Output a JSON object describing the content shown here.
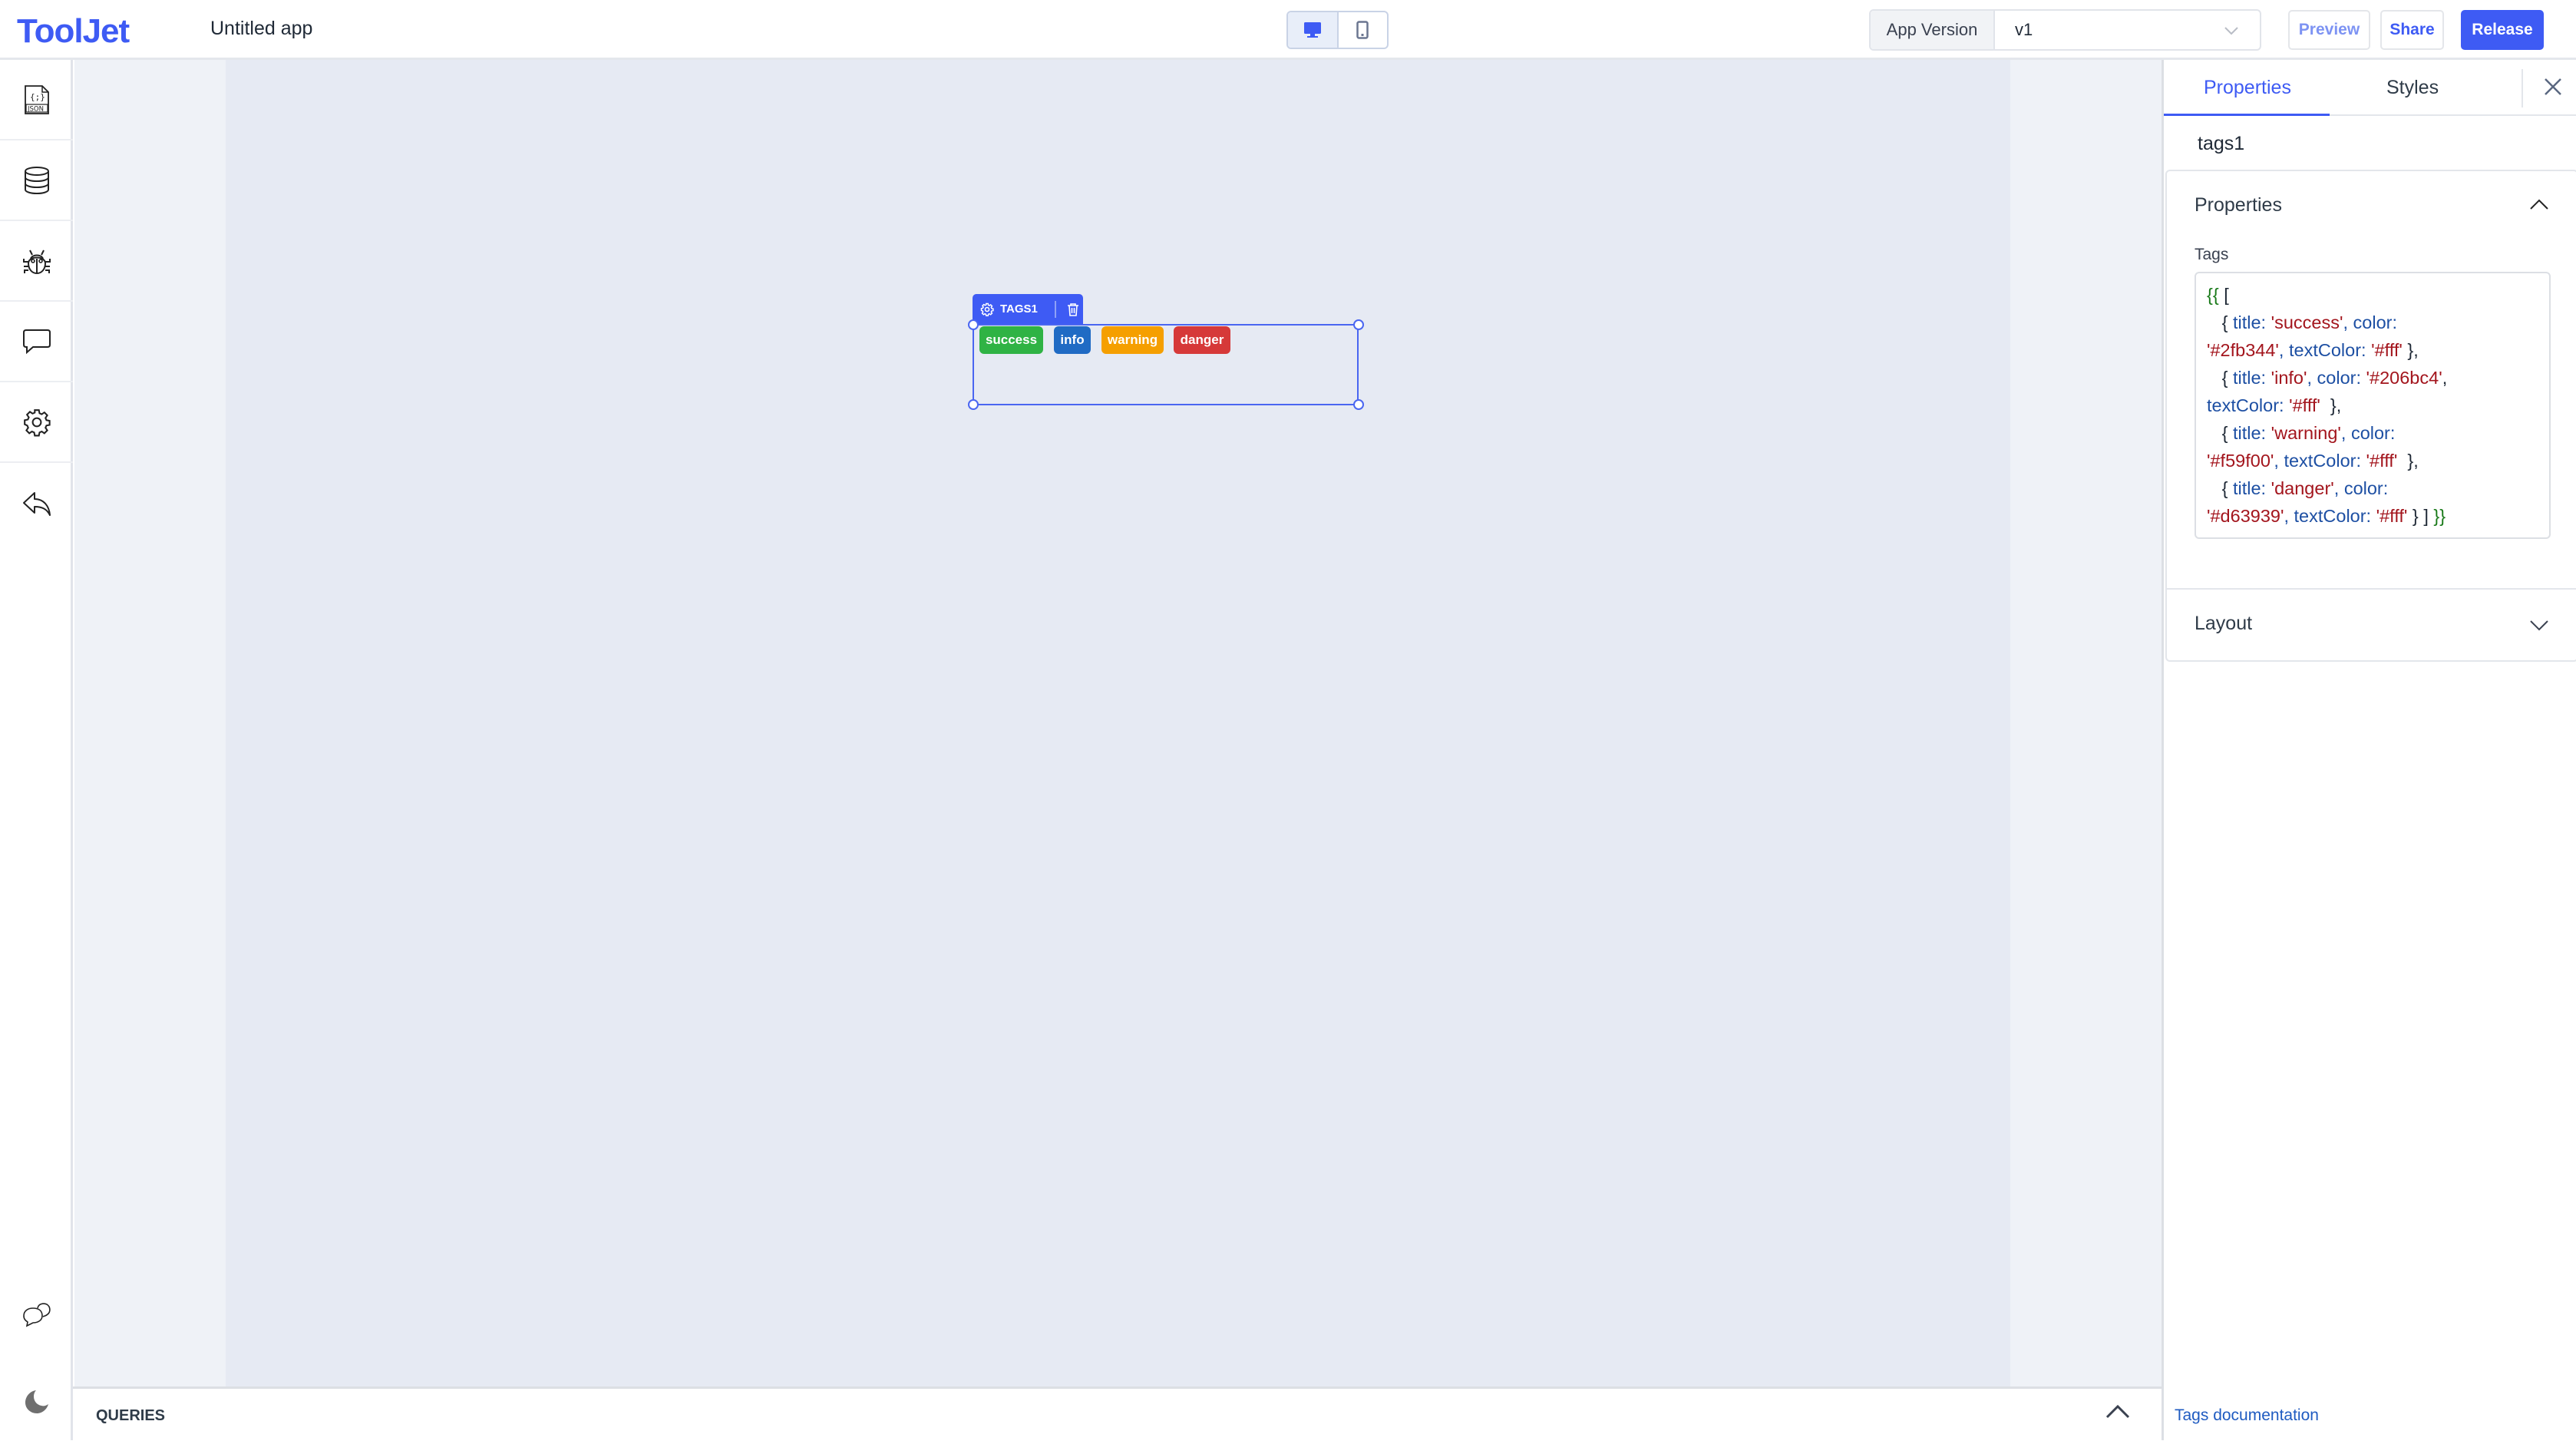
{
  "header": {
    "logo": "ToolJet",
    "app_name": "Untitled app",
    "device_toggle": {
      "desktop_icon": "desktop-icon",
      "mobile_icon": "mobile-icon",
      "active": "desktop"
    },
    "version_label": "App Version",
    "version_value": "v1",
    "preview_label": "Preview",
    "share_label": "Share",
    "release_label": "Release"
  },
  "sidebar": {
    "items": [
      {
        "name": "inspector",
        "icon": "json-file-icon"
      },
      {
        "name": "data-sources",
        "icon": "database-icon"
      },
      {
        "name": "debugger",
        "icon": "bug-icon"
      },
      {
        "name": "comments",
        "icon": "comment-icon"
      },
      {
        "name": "settings",
        "icon": "gear-icon"
      },
      {
        "name": "back",
        "icon": "reply-arrow-icon"
      }
    ],
    "bottom_items": [
      {
        "name": "chat",
        "icon": "chat-bubbles-icon"
      },
      {
        "name": "dark-mode",
        "icon": "moon-icon"
      }
    ]
  },
  "canvas": {
    "widget": {
      "label": "TAGS1",
      "tags": [
        {
          "title": "success",
          "color": "#2fb344",
          "textColor": "#fff"
        },
        {
          "title": "info",
          "color": "#206bc4",
          "textColor": "#fff"
        },
        {
          "title": "warning",
          "color": "#f59f00",
          "textColor": "#fff"
        },
        {
          "title": "danger",
          "color": "#d63939",
          "textColor": "#fff"
        }
      ]
    }
  },
  "queries": {
    "label": "QUERIES"
  },
  "panel": {
    "tabs": [
      {
        "label": "Properties",
        "active": true
      },
      {
        "label": "Styles",
        "active": false
      }
    ],
    "component_name": "tags1",
    "properties_section": {
      "title": "Properties",
      "field_label": "Tags",
      "code_lines": [
        [
          {
            "t": "b",
            "v": "{{"
          },
          {
            "t": "p",
            "v": " ["
          }
        ],
        [
          {
            "t": "p",
            "v": "   { "
          },
          {
            "t": "k",
            "v": "title: "
          },
          {
            "t": "s",
            "v": "'success'"
          },
          {
            "t": "k",
            "v": ", color:"
          }
        ],
        [
          {
            "t": "s",
            "v": "'#2fb344'"
          },
          {
            "t": "k",
            "v": ", textColor: "
          },
          {
            "t": "s",
            "v": "'#fff'"
          },
          {
            "t": "p",
            "v": " },"
          }
        ],
        [
          {
            "t": "p",
            "v": "   { "
          },
          {
            "t": "k",
            "v": "title: "
          },
          {
            "t": "s",
            "v": "'info'"
          },
          {
            "t": "k",
            "v": ", color: "
          },
          {
            "t": "s",
            "v": "'#206bc4'"
          },
          {
            "t": "p",
            "v": ","
          }
        ],
        [
          {
            "t": "k",
            "v": "textColor: "
          },
          {
            "t": "s",
            "v": "'#fff'"
          },
          {
            "t": "p",
            "v": "  },"
          }
        ],
        [
          {
            "t": "p",
            "v": "   { "
          },
          {
            "t": "k",
            "v": "title: "
          },
          {
            "t": "s",
            "v": "'warning'"
          },
          {
            "t": "k",
            "v": ", color:"
          }
        ],
        [
          {
            "t": "s",
            "v": "'#f59f00'"
          },
          {
            "t": "k",
            "v": ", textColor: "
          },
          {
            "t": "s",
            "v": "'#fff'"
          },
          {
            "t": "p",
            "v": "  },"
          }
        ],
        [
          {
            "t": "p",
            "v": "   { "
          },
          {
            "t": "k",
            "v": "title: "
          },
          {
            "t": "s",
            "v": "'danger'"
          },
          {
            "t": "k",
            "v": ", color:"
          }
        ],
        [
          {
            "t": "s",
            "v": "'#d63939'"
          },
          {
            "t": "k",
            "v": ", textColor: "
          },
          {
            "t": "s",
            "v": "'#fff'"
          },
          {
            "t": "p",
            "v": " } ] "
          },
          {
            "t": "b",
            "v": "}}"
          }
        ]
      ]
    },
    "layout_section": {
      "title": "Layout"
    },
    "doc_link": "Tags documentation"
  },
  "colors": {
    "brand": "#3e5bf4",
    "canvas_bg": "#e6eaf3",
    "canvas_outer": "#eff2f7"
  }
}
